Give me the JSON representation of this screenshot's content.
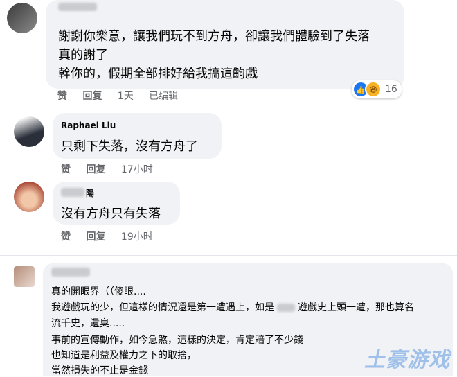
{
  "comments": [
    {
      "name": "",
      "lines": [
        "謝謝你樂意，讓我們玩不到方舟，卻讓我們體驗到了失落",
        "真的謝了",
        "幹你的，假期全部排好給我搞這齣戲"
      ],
      "actions": {
        "like": "赞",
        "reply": "回复",
        "time": "1天",
        "edited": "已编辑"
      },
      "reactions": {
        "count": "16",
        "icons": [
          "like-icon",
          "haha-icon"
        ]
      }
    },
    {
      "name": "Raphael Liu",
      "lines": [
        "只剩下失落，沒有方舟了"
      ],
      "actions": {
        "like": "赞",
        "reply": "回复",
        "time": "17小时"
      }
    },
    {
      "name": "陽",
      "lines": [
        "沒有方舟只有失落"
      ],
      "actions": {
        "like": "赞",
        "reply": "回复",
        "time": "19小时"
      }
    },
    {
      "name": "",
      "lines": [
        "真的開眼界（（傻眼....",
        "我遊戲玩的少，但這樣的情況還是第一遭遇上，如是",
        "遊戲史上頭一遭，那也算名",
        "流千史，遺臭.....",
        "事前的宣傳動作，如今急煞，這樣的決定，肯定賠了不少錢",
        "也知道是利益及權力之下的取捨，",
        "當然損失的不止是金錢"
      ]
    }
  ],
  "watermark": "土豪游戏"
}
